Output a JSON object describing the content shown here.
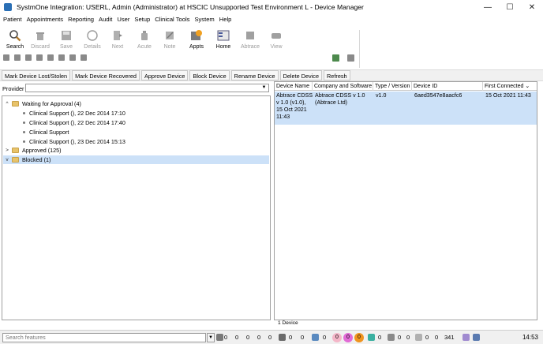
{
  "window": {
    "title": "SystmOne Integration: USERL, Admin (Administrator) at HSCIC Unsupported Test Environment L - Device Manager",
    "minimize_glyph": "—",
    "maximize_glyph": "☐",
    "close_glyph": "✕"
  },
  "menu": [
    "Patient",
    "Appointments",
    "Reporting",
    "Audit",
    "User",
    "Setup",
    "Clinical Tools",
    "System",
    "Help"
  ],
  "toolbar": {
    "buttons": [
      {
        "label": "Search",
        "icon": "search-icon",
        "enabled": true
      },
      {
        "label": "Discard",
        "icon": "trash-icon",
        "enabled": false
      },
      {
        "label": "Save",
        "icon": "save-icon",
        "enabled": false
      },
      {
        "label": "Details",
        "icon": "details-icon",
        "enabled": false
      },
      {
        "label": "Next",
        "icon": "next-icon",
        "enabled": false
      },
      {
        "label": "Acute",
        "icon": "acute-icon",
        "enabled": false
      },
      {
        "label": "Note",
        "icon": "note-icon",
        "enabled": false
      },
      {
        "label": "Appts",
        "icon": "appointments-icon",
        "enabled": true
      },
      {
        "label": "Home",
        "icon": "home-icon",
        "enabled": true
      },
      {
        "label": "Abtrace",
        "icon": "abtrace-icon",
        "enabled": false
      },
      {
        "label": "View",
        "icon": "view-icon",
        "enabled": false
      }
    ]
  },
  "actions": [
    "Mark Device Lost/Stolen",
    "Mark Device Recovered",
    "Approve Device",
    "Block Device",
    "Rename Device",
    "Delete Device",
    "Refresh"
  ],
  "provider": {
    "label": "Provider",
    "value": "",
    "caret": "▼"
  },
  "tree": {
    "waiting": {
      "label": "Waiting for Approval (4)",
      "expander": "^"
    },
    "waiting_items": [
      "Clinical Support (), 22 Dec 2014 17:10",
      "Clinical Support (), 22 Dec 2014 17:40",
      "Clinical Support",
      "Clinical Support (), 23 Dec 2014 15:13"
    ],
    "approved": {
      "label": "Approved (125)",
      "expander": ">"
    },
    "blocked": {
      "label": "Blocked (1)",
      "expander": "v"
    }
  },
  "table": {
    "columns": [
      "Device Name",
      "Company and Software",
      "Type / Version",
      "Device ID",
      "First Connected"
    ],
    "sort_indicator": "⌄",
    "rows": [
      {
        "name_lines": [
          "Abtrace CDSS",
          "v 1.0 (v1.0),",
          "15 Oct 2021",
          "11:43"
        ],
        "company_lines": [
          "Abtrace CDSS v 1.0",
          "(Abtrace Ltd)"
        ],
        "type_version": "v1.0",
        "device_id": "6aed3547e8aacfc6",
        "first_connected": "15 Oct 2021 11:43"
      }
    ],
    "footer": "1 Device"
  },
  "status": {
    "search_placeholder": "Search features",
    "search_caret": "▼",
    "counters": [
      "0",
      "0",
      "0",
      "0",
      "0",
      "0",
      "0",
      "0",
      "0",
      "0",
      "0",
      "0",
      "0",
      "0",
      "0",
      "0",
      "0",
      "0",
      "0",
      "341"
    ],
    "time": "14:53"
  }
}
